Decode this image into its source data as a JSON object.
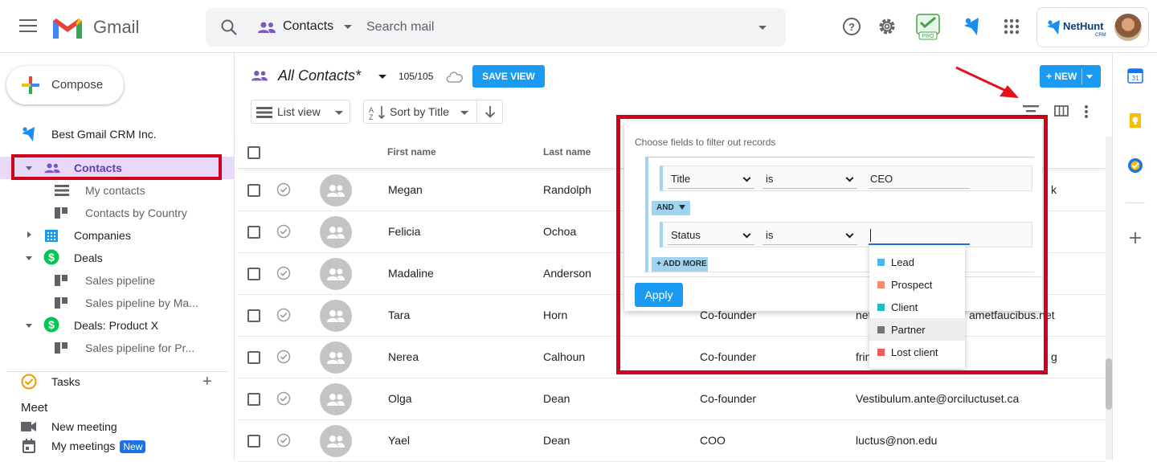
{
  "topbar": {
    "app_name": "Gmail",
    "search": {
      "scope": "Contacts",
      "placeholder": "Search mail"
    },
    "pro_label": "PRO",
    "account": {
      "logo_text": "NetHunt",
      "logo_sub": "CRM"
    }
  },
  "sidebar": {
    "compose_label": "Compose",
    "workspace": "Best Gmail CRM Inc.",
    "items": [
      {
        "label": "Contacts",
        "level": 0,
        "expanded": true,
        "selected": true,
        "icon": "people-icon"
      },
      {
        "label": "My contacts",
        "level": 1,
        "icon": "list-view-icon"
      },
      {
        "label": "Contacts by Country",
        "level": 1,
        "icon": "board-view-icon"
      },
      {
        "label": "Companies",
        "level": 0,
        "expanded": false,
        "icon": "building-icon"
      },
      {
        "label": "Deals",
        "level": 0,
        "expanded": true,
        "icon": "dollar-icon"
      },
      {
        "label": "Sales pipeline",
        "level": 1,
        "icon": "board-view-icon"
      },
      {
        "label": "Sales pipeline by Ma...",
        "level": 1,
        "icon": "board-view-icon"
      },
      {
        "label": "Deals: Product X",
        "level": 0,
        "expanded": true,
        "icon": "dollar-icon"
      },
      {
        "label": "Sales pipeline for Pr...",
        "level": 1,
        "icon": "board-view-icon"
      }
    ],
    "tasks_label": "Tasks",
    "meet": {
      "title": "Meet",
      "new_meeting": "New meeting",
      "my_meetings": "My meetings",
      "new_badge": "New"
    }
  },
  "view": {
    "title": "All Contacts*",
    "count": "105/105",
    "save_view": "SAVE VIEW",
    "new_button": "+ NEW",
    "list_view": "List view",
    "sort_by": "Sort by Title"
  },
  "table": {
    "columns": [
      "First name",
      "Last name"
    ],
    "rows": [
      {
        "first": "Megan",
        "last": "Randolph",
        "title": "",
        "email": "",
        "email_tail": "k"
      },
      {
        "first": "Felicia",
        "last": "Ochoa",
        "title": "",
        "email": "",
        "email_tail": ""
      },
      {
        "first": "Madaline",
        "last": "Anderson",
        "title": "",
        "email": "",
        "email_tail": ""
      },
      {
        "first": "Tara",
        "last": "Horn",
        "title": "Co-founder",
        "email": "net",
        "email_tail": "ametfaucibus.net"
      },
      {
        "first": "Nerea",
        "last": "Calhoun",
        "title": "Co-founder",
        "email": "frin",
        "email_tail": "g"
      },
      {
        "first": "Olga",
        "last": "Dean",
        "title": "Co-founder",
        "email": "Vestibulum.ante@orciluctuset.ca",
        "email_tail": ""
      },
      {
        "first": "Yael",
        "last": "Dean",
        "title": "COO",
        "email": "luctus@non.edu",
        "email_tail": ""
      }
    ]
  },
  "filter": {
    "hint": "Choose fields to filter out records",
    "conditions": [
      {
        "field": "Title",
        "operator": "is",
        "value": "CEO"
      },
      {
        "field": "Status",
        "operator": "is",
        "value": ""
      }
    ],
    "and_label": "AND",
    "add_more": "+ ADD MORE",
    "apply": "Apply",
    "status_options": [
      {
        "label": "Lead",
        "color": "#4fb3f0"
      },
      {
        "label": "Prospect",
        "color": "#f58a6c"
      },
      {
        "label": "Client",
        "color": "#1fbcc6"
      },
      {
        "label": "Partner",
        "color": "#757575"
      },
      {
        "label": "Lost client",
        "color": "#f05a5a"
      }
    ]
  },
  "colors": {
    "accent": "#1a9af0",
    "highlight_red": "#d0021b",
    "contacts_purple": "#673ab7"
  }
}
